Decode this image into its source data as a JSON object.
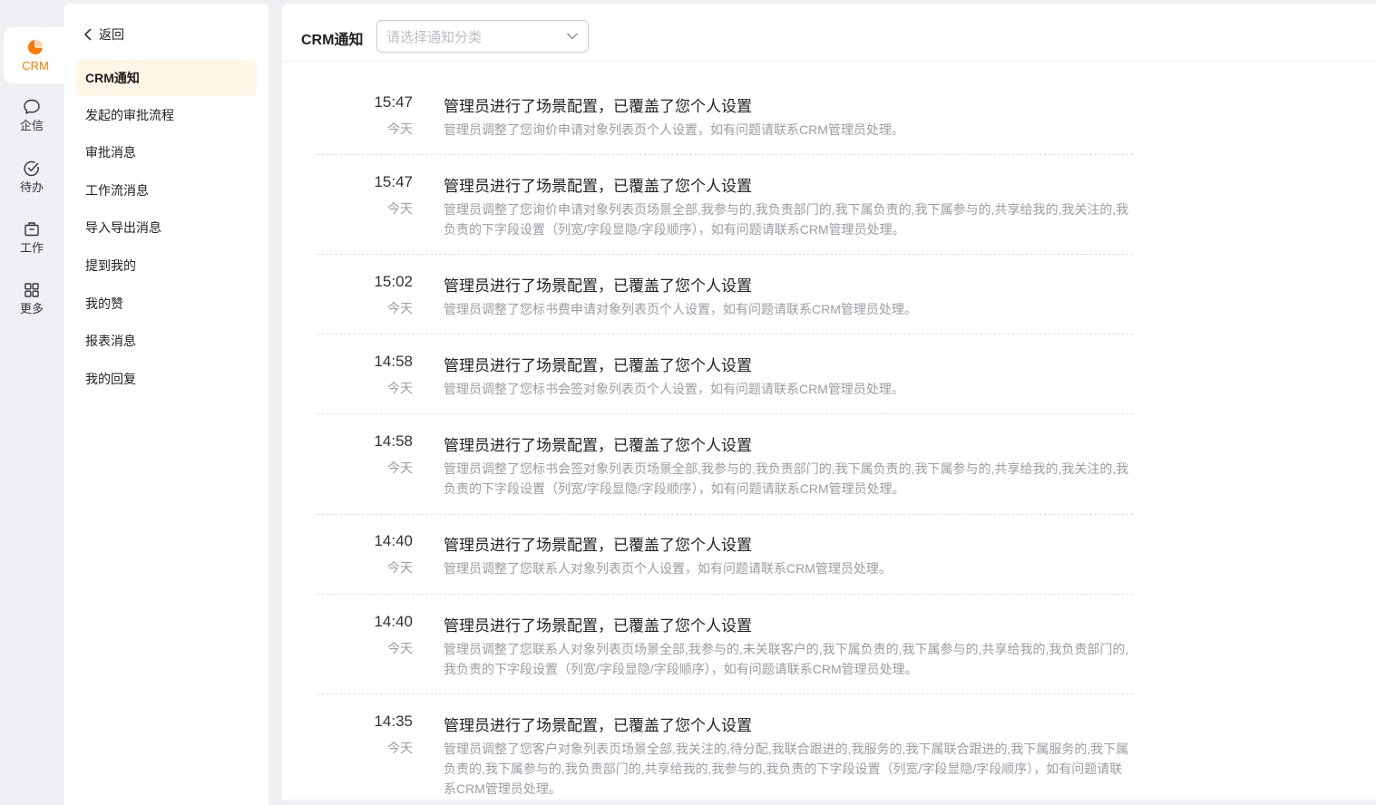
{
  "rail": [
    {
      "label": "CRM",
      "icon": "pie-chart-icon",
      "active": true
    },
    {
      "label": "企信",
      "icon": "chat-bubble-icon"
    },
    {
      "label": "待办",
      "icon": "check-circle-icon"
    },
    {
      "label": "工作",
      "icon": "briefcase-icon"
    },
    {
      "label": "更多",
      "icon": "grid-icon"
    }
  ],
  "sidebar": {
    "back_label": "返回",
    "items": [
      {
        "label": "CRM通知",
        "active": true
      },
      {
        "label": "发起的审批流程"
      },
      {
        "label": "审批消息"
      },
      {
        "label": "工作流消息"
      },
      {
        "label": "导入导出消息"
      },
      {
        "label": "提到我的"
      },
      {
        "label": "我的赞"
      },
      {
        "label": "报表消息"
      },
      {
        "label": "我的回复"
      }
    ]
  },
  "header": {
    "title": "CRM通知",
    "category_placeholder": "请选择通知分类"
  },
  "notifications": [
    {
      "time": "15:47",
      "day": "今天",
      "title": "管理员进行了场景配置，已覆盖了您个人设置",
      "desc": "管理员调整了您询价申请对象列表页个人设置，如有问题请联系CRM管理员处理。"
    },
    {
      "time": "15:47",
      "day": "今天",
      "title": "管理员进行了场景配置，已覆盖了您个人设置",
      "desc": "管理员调整了您询价申请对象列表页场景全部,我参与的,我负责部门的,我下属负责的,我下属参与的,共享给我的,我关注的,我负责的下字段设置（列宽/字段显隐/字段顺序），如有问题请联系CRM管理员处理。"
    },
    {
      "time": "15:02",
      "day": "今天",
      "title": "管理员进行了场景配置，已覆盖了您个人设置",
      "desc": "管理员调整了您标书费申请对象列表页个人设置，如有问题请联系CRM管理员处理。"
    },
    {
      "time": "14:58",
      "day": "今天",
      "title": "管理员进行了场景配置，已覆盖了您个人设置",
      "desc": "管理员调整了您标书会签对象列表页个人设置，如有问题请联系CRM管理员处理。"
    },
    {
      "time": "14:58",
      "day": "今天",
      "title": "管理员进行了场景配置，已覆盖了您个人设置",
      "desc": "管理员调整了您标书会签对象列表页场景全部,我参与的,我负责部门的,我下属负责的,我下属参与的,共享给我的,我关注的,我负责的下字段设置（列宽/字段显隐/字段顺序），如有问题请联系CRM管理员处理。"
    },
    {
      "time": "14:40",
      "day": "今天",
      "title": "管理员进行了场景配置，已覆盖了您个人设置",
      "desc": "管理员调整了您联系人对象列表页个人设置，如有问题请联系CRM管理员处理。"
    },
    {
      "time": "14:40",
      "day": "今天",
      "title": "管理员进行了场景配置，已覆盖了您个人设置",
      "desc": "管理员调整了您联系人对象列表页场景全部,我参与的,未关联客户的,我下属负责的,我下属参与的,共享给我的,我负责部门的,我负责的下字段设置（列宽/字段显隐/字段顺序），如有问题请联系CRM管理员处理。"
    },
    {
      "time": "14:35",
      "day": "今天",
      "title": "管理员进行了场景配置，已覆盖了您个人设置",
      "desc": "管理员调整了您客户对象列表页场景全部,我关注的,待分配,我联合跟进的,我服务的,我下属联合跟进的,我下属服务的,我下属负责的,我下属参与的,我负责部门的,共享给我的,我参与的,我负责的下字段设置（列宽/字段显隐/字段顺序），如有问题请联系CRM管理员处理。"
    }
  ],
  "colors": {
    "accent": "#ff7a00",
    "active_bg": "#fff5e6"
  }
}
